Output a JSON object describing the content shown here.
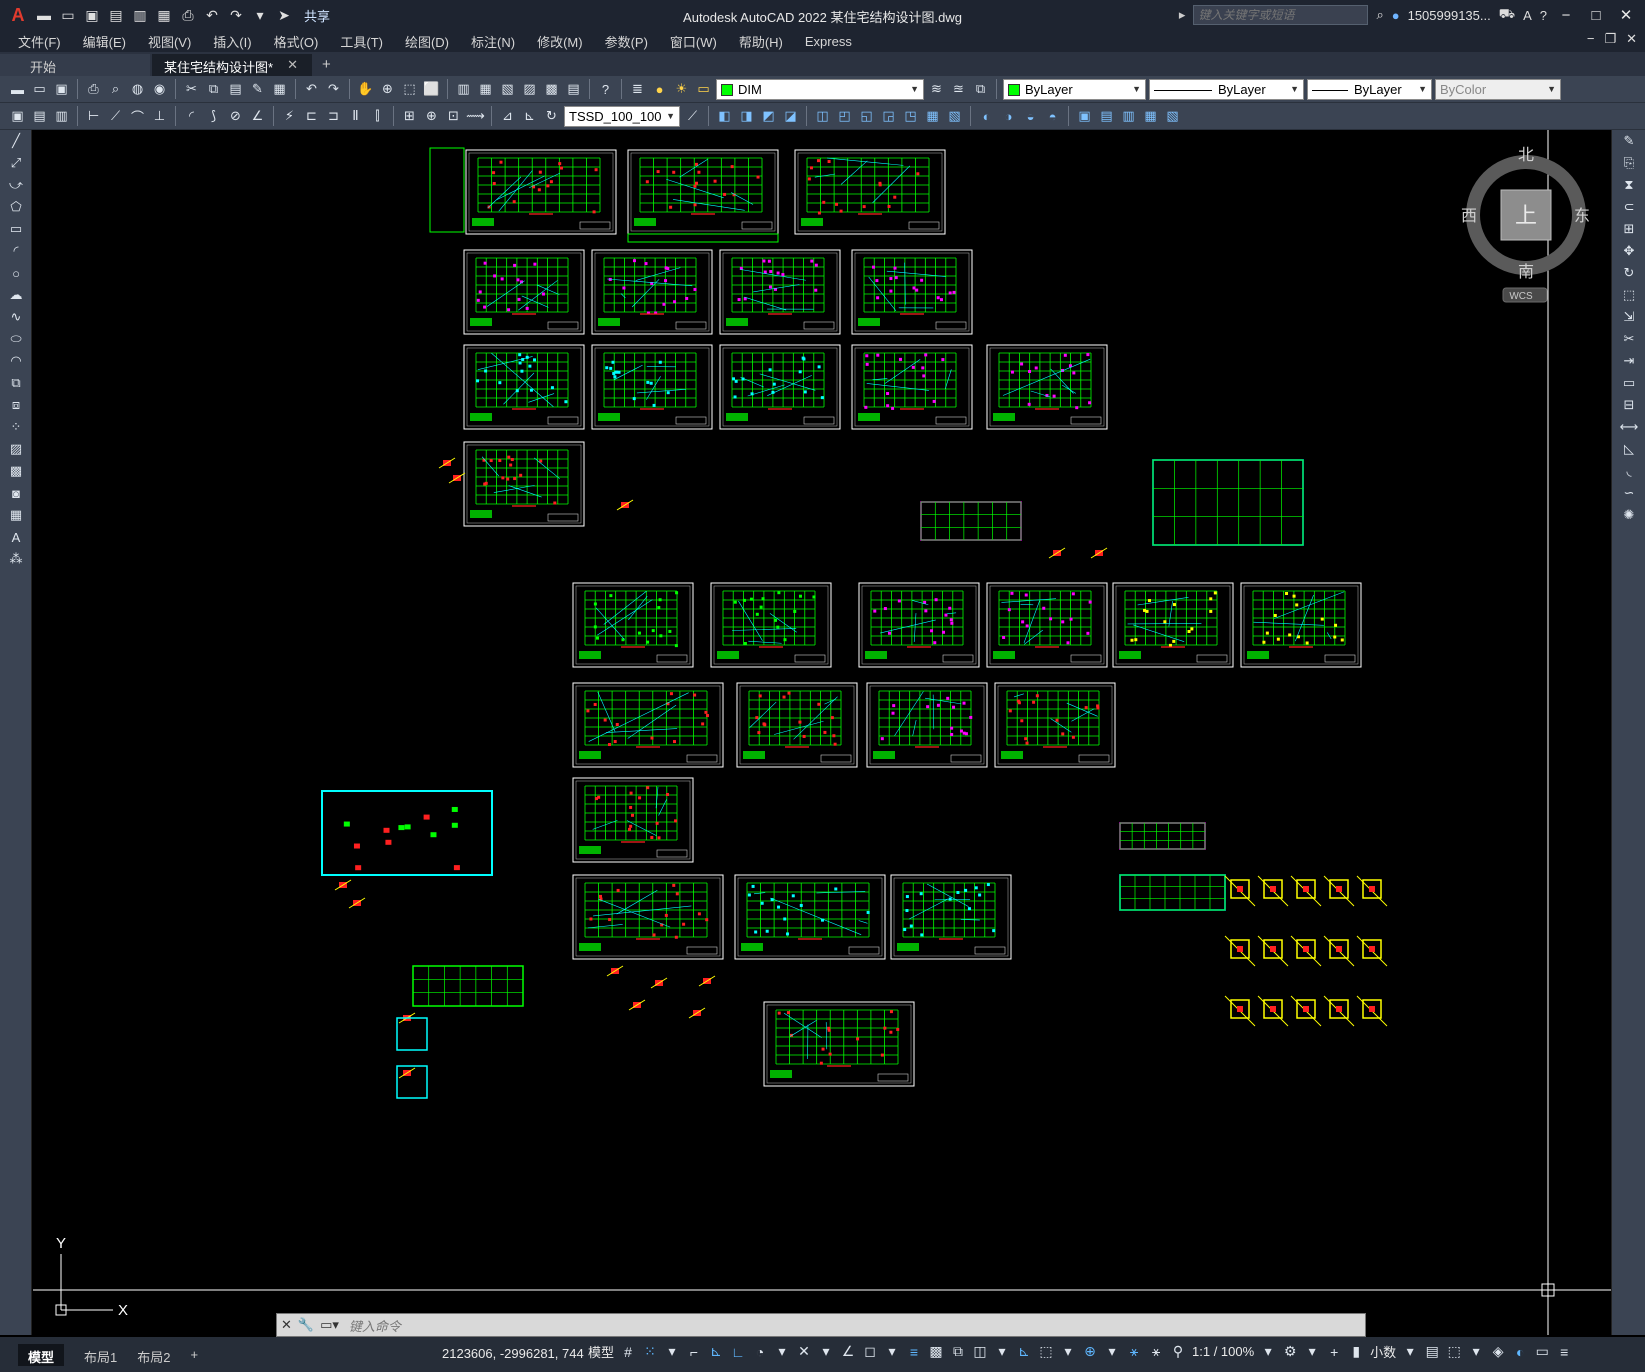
{
  "window": {
    "title": "Autodesk AutoCAD 2022    某住宅结构设计图.dwg",
    "search_placeholder": "键入关键字或短语",
    "user": "1505999135...",
    "share": "共享",
    "logo": "A"
  },
  "menu": [
    "文件(F)",
    "编辑(E)",
    "视图(V)",
    "插入(I)",
    "格式(O)",
    "工具(T)",
    "绘图(D)",
    "标注(N)",
    "修改(M)",
    "参数(P)",
    "窗口(W)",
    "帮助(H)",
    "Express"
  ],
  "tabs": {
    "start": "开始",
    "drawing": "某住宅结构设计图*"
  },
  "toolbar": {
    "layer": "DIM",
    "color": "ByLayer",
    "linetype": "ByLayer",
    "lineweight": "ByLayer",
    "plotstyle": "ByColor",
    "dimstyle": "TSSD_100_100"
  },
  "viewcube": {
    "north": "北",
    "south": "南",
    "east": "东",
    "west": "西",
    "top": "上",
    "wcs": "WCS"
  },
  "ucs": {
    "x": "X",
    "y": "Y"
  },
  "command": {
    "placeholder": "键入命令"
  },
  "layouts": [
    "模型",
    "布局1",
    "布局2",
    "+"
  ],
  "statusbar": {
    "coords": "2123606, -2996281, 744",
    "model": "模型",
    "scale": "1:1 / 100%",
    "units": "小数"
  },
  "colors": {
    "bg": "#000000",
    "chrome": "#3b4453",
    "title": "#1e2430",
    "green": "#00ff00",
    "cyan": "#00ffff",
    "magenta": "#ff00ff",
    "yellow": "#ffff00",
    "red": "#ff2020"
  }
}
